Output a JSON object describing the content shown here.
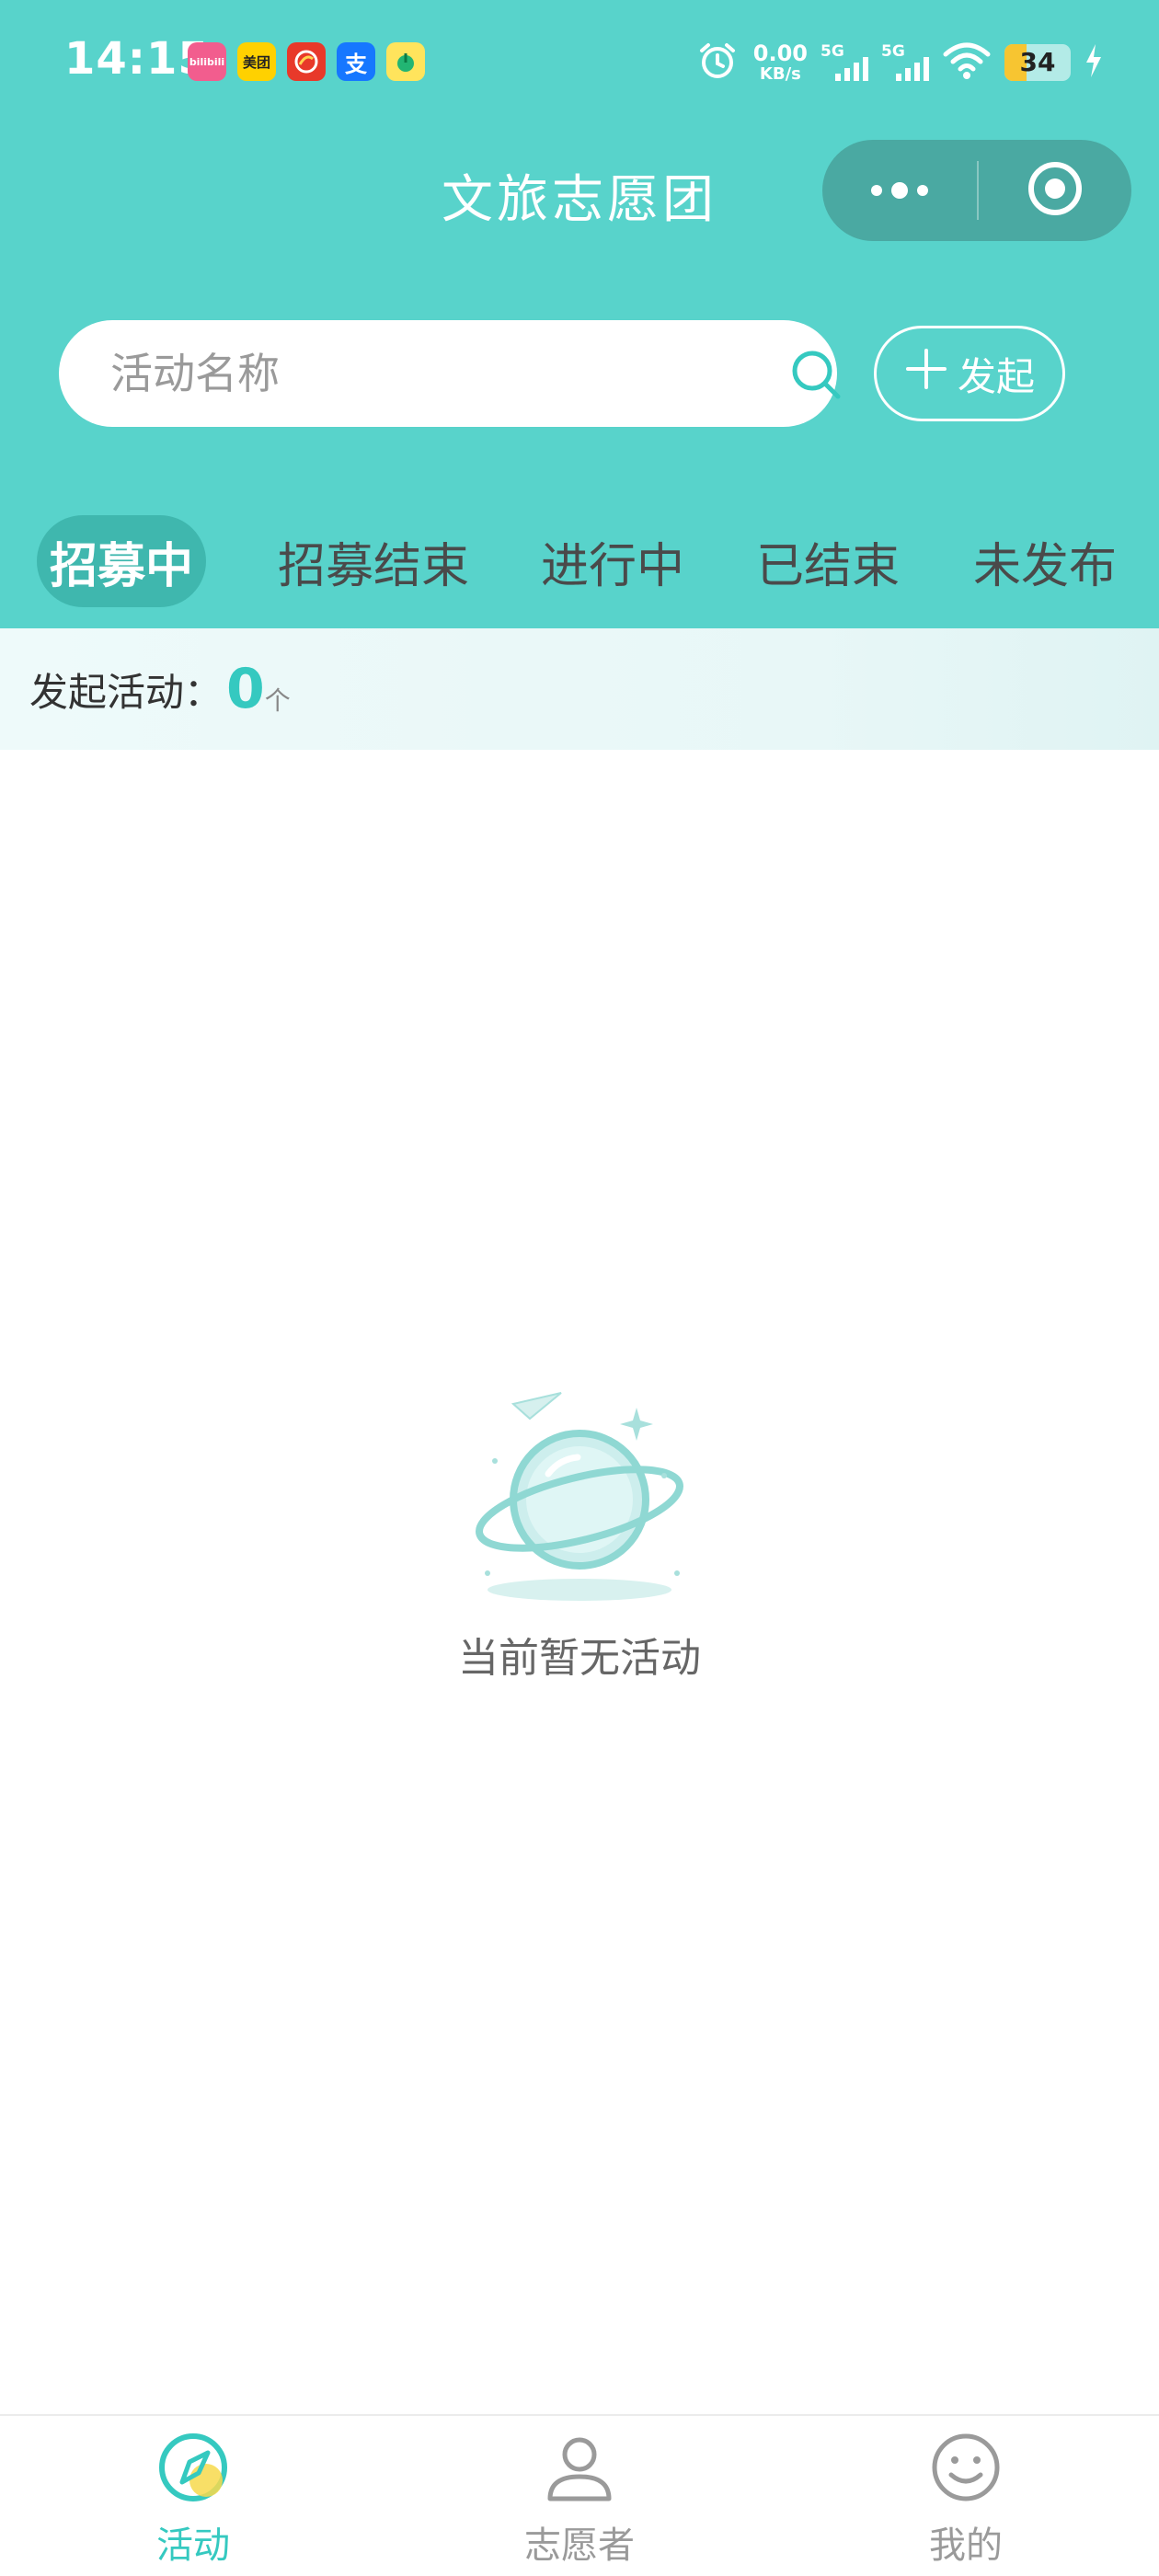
{
  "status_bar": {
    "time": "14:15",
    "net_speed_value": "0.00",
    "net_speed_unit": "KB/s",
    "signal_1": "5G",
    "signal_2": "5G",
    "battery": "34",
    "app_icons": [
      {
        "name": "bilibili-icon",
        "text": "bilibili",
        "color": "#f25d8e"
      },
      {
        "name": "meituan-icon",
        "text": "美团",
        "color": "#ffd100"
      },
      {
        "name": "news-app-icon",
        "text": "",
        "color": "#e8392a"
      },
      {
        "name": "alipay-icon",
        "text": "支",
        "color": "#1677ff"
      },
      {
        "name": "qq-music-icon",
        "text": "",
        "color": "#ffe45c"
      }
    ]
  },
  "header": {
    "title": "文旅志愿团",
    "background": "#58d3cb"
  },
  "search": {
    "placeholder": "活动名称",
    "launch_label": "发起"
  },
  "tabs": [
    {
      "label": "招募中",
      "active": true
    },
    {
      "label": "招募结束",
      "active": false
    },
    {
      "label": "进行中",
      "active": false
    },
    {
      "label": "已结束",
      "active": false
    },
    {
      "label": "未发布",
      "active": false
    }
  ],
  "summary": {
    "label": "发起活动：",
    "count": "0",
    "unit": "个"
  },
  "empty_state": {
    "message": "当前暂无活动"
  },
  "tabbar": {
    "items": [
      {
        "label": "活动",
        "icon": "compass-icon",
        "active": true
      },
      {
        "label": "志愿者",
        "icon": "person-icon",
        "active": false
      },
      {
        "label": "我的",
        "icon": "smiley-icon",
        "active": false
      }
    ],
    "accent": "#35c9c0"
  }
}
